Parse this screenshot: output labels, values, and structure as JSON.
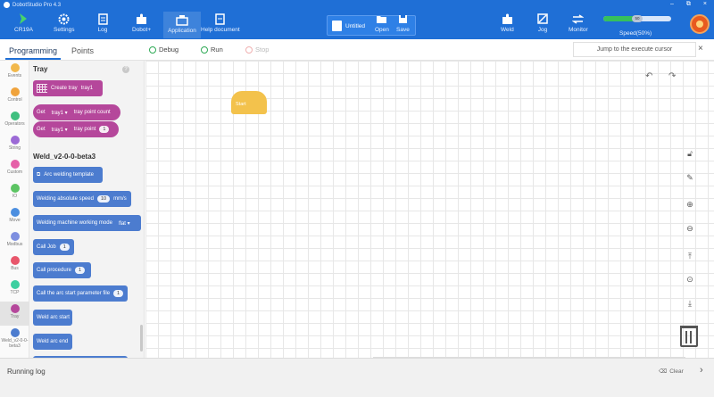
{
  "window": {
    "title": "DobotStudio Pro 4.3",
    "controls": [
      "–",
      "⧉",
      "×"
    ]
  },
  "toolbar": {
    "robot_name": "CR19A",
    "settings": "Settings",
    "log": "Log",
    "dobot_plus": "Dobot+",
    "application": "Application",
    "help": "Help document",
    "document_name": "Untitled",
    "open": "Open",
    "save": "Save",
    "weld": "Weld",
    "jog": "Jog",
    "monitor": "Monitor",
    "speed_label": "Speed(50%)",
    "speed_knob": "50",
    "speed_fraction": 0.5,
    "colors": {
      "toolbar": "#1f6fd6",
      "speed": "#36c05c"
    }
  },
  "header": {
    "tab_programming": "Programming",
    "tab_points": "Points",
    "debug": "Debug",
    "run": "Run",
    "stop": "Stop",
    "jump": "Jump to the execute cursor",
    "close": "×"
  },
  "categories": [
    {
      "label": "Events",
      "color": "#f2b84b"
    },
    {
      "label": "Control",
      "color": "#f0a33c"
    },
    {
      "label": "Operators",
      "color": "#3fbf7f"
    },
    {
      "label": "String",
      "color": "#9c6ad6"
    },
    {
      "label": "Custom",
      "color": "#e560a8"
    },
    {
      "label": "IO",
      "color": "#5cc463"
    },
    {
      "label": "Move",
      "color": "#4c8fe0"
    },
    {
      "label": "Modbus",
      "color": "#7e8fe0"
    },
    {
      "label": "Bus",
      "color": "#e8566b"
    },
    {
      "label": "TCP",
      "color": "#3ccfa0"
    },
    {
      "label": "Tray",
      "color": "#b5479b"
    },
    {
      "label": "Weld_v2-0-0-beta3",
      "color": "#4c7ccf"
    }
  ],
  "palette": {
    "section_tray": "Tray",
    "help": "?",
    "create_tray": "Create tray",
    "tray_name": "tray1",
    "get": "Get",
    "tray_point_count": "tray point count",
    "tray_point": "tray point",
    "tray_point_index": "1",
    "section_weld": "Weld_v2-0-0-beta3",
    "arc_template": "Arc welding template",
    "weld_speed": "Welding absolute speed",
    "weld_speed_value": "10",
    "weld_speed_unit": "mm/s",
    "weld_mode": "Welding machine working mode",
    "weld_mode_value": "flat",
    "call_job": "Call Job",
    "call_job_value": "1",
    "call_procedure": "Call procedure",
    "call_procedure_value": "1",
    "call_arc_file": "Call the arc start parameter file",
    "call_arc_file_value": "1",
    "weld_arc_start": "Weld arc start",
    "weld_arc_end": "Weld arc end"
  },
  "canvas": {
    "start_block": "Start"
  },
  "log": {
    "title": "Running log",
    "clear": "Clear"
  }
}
